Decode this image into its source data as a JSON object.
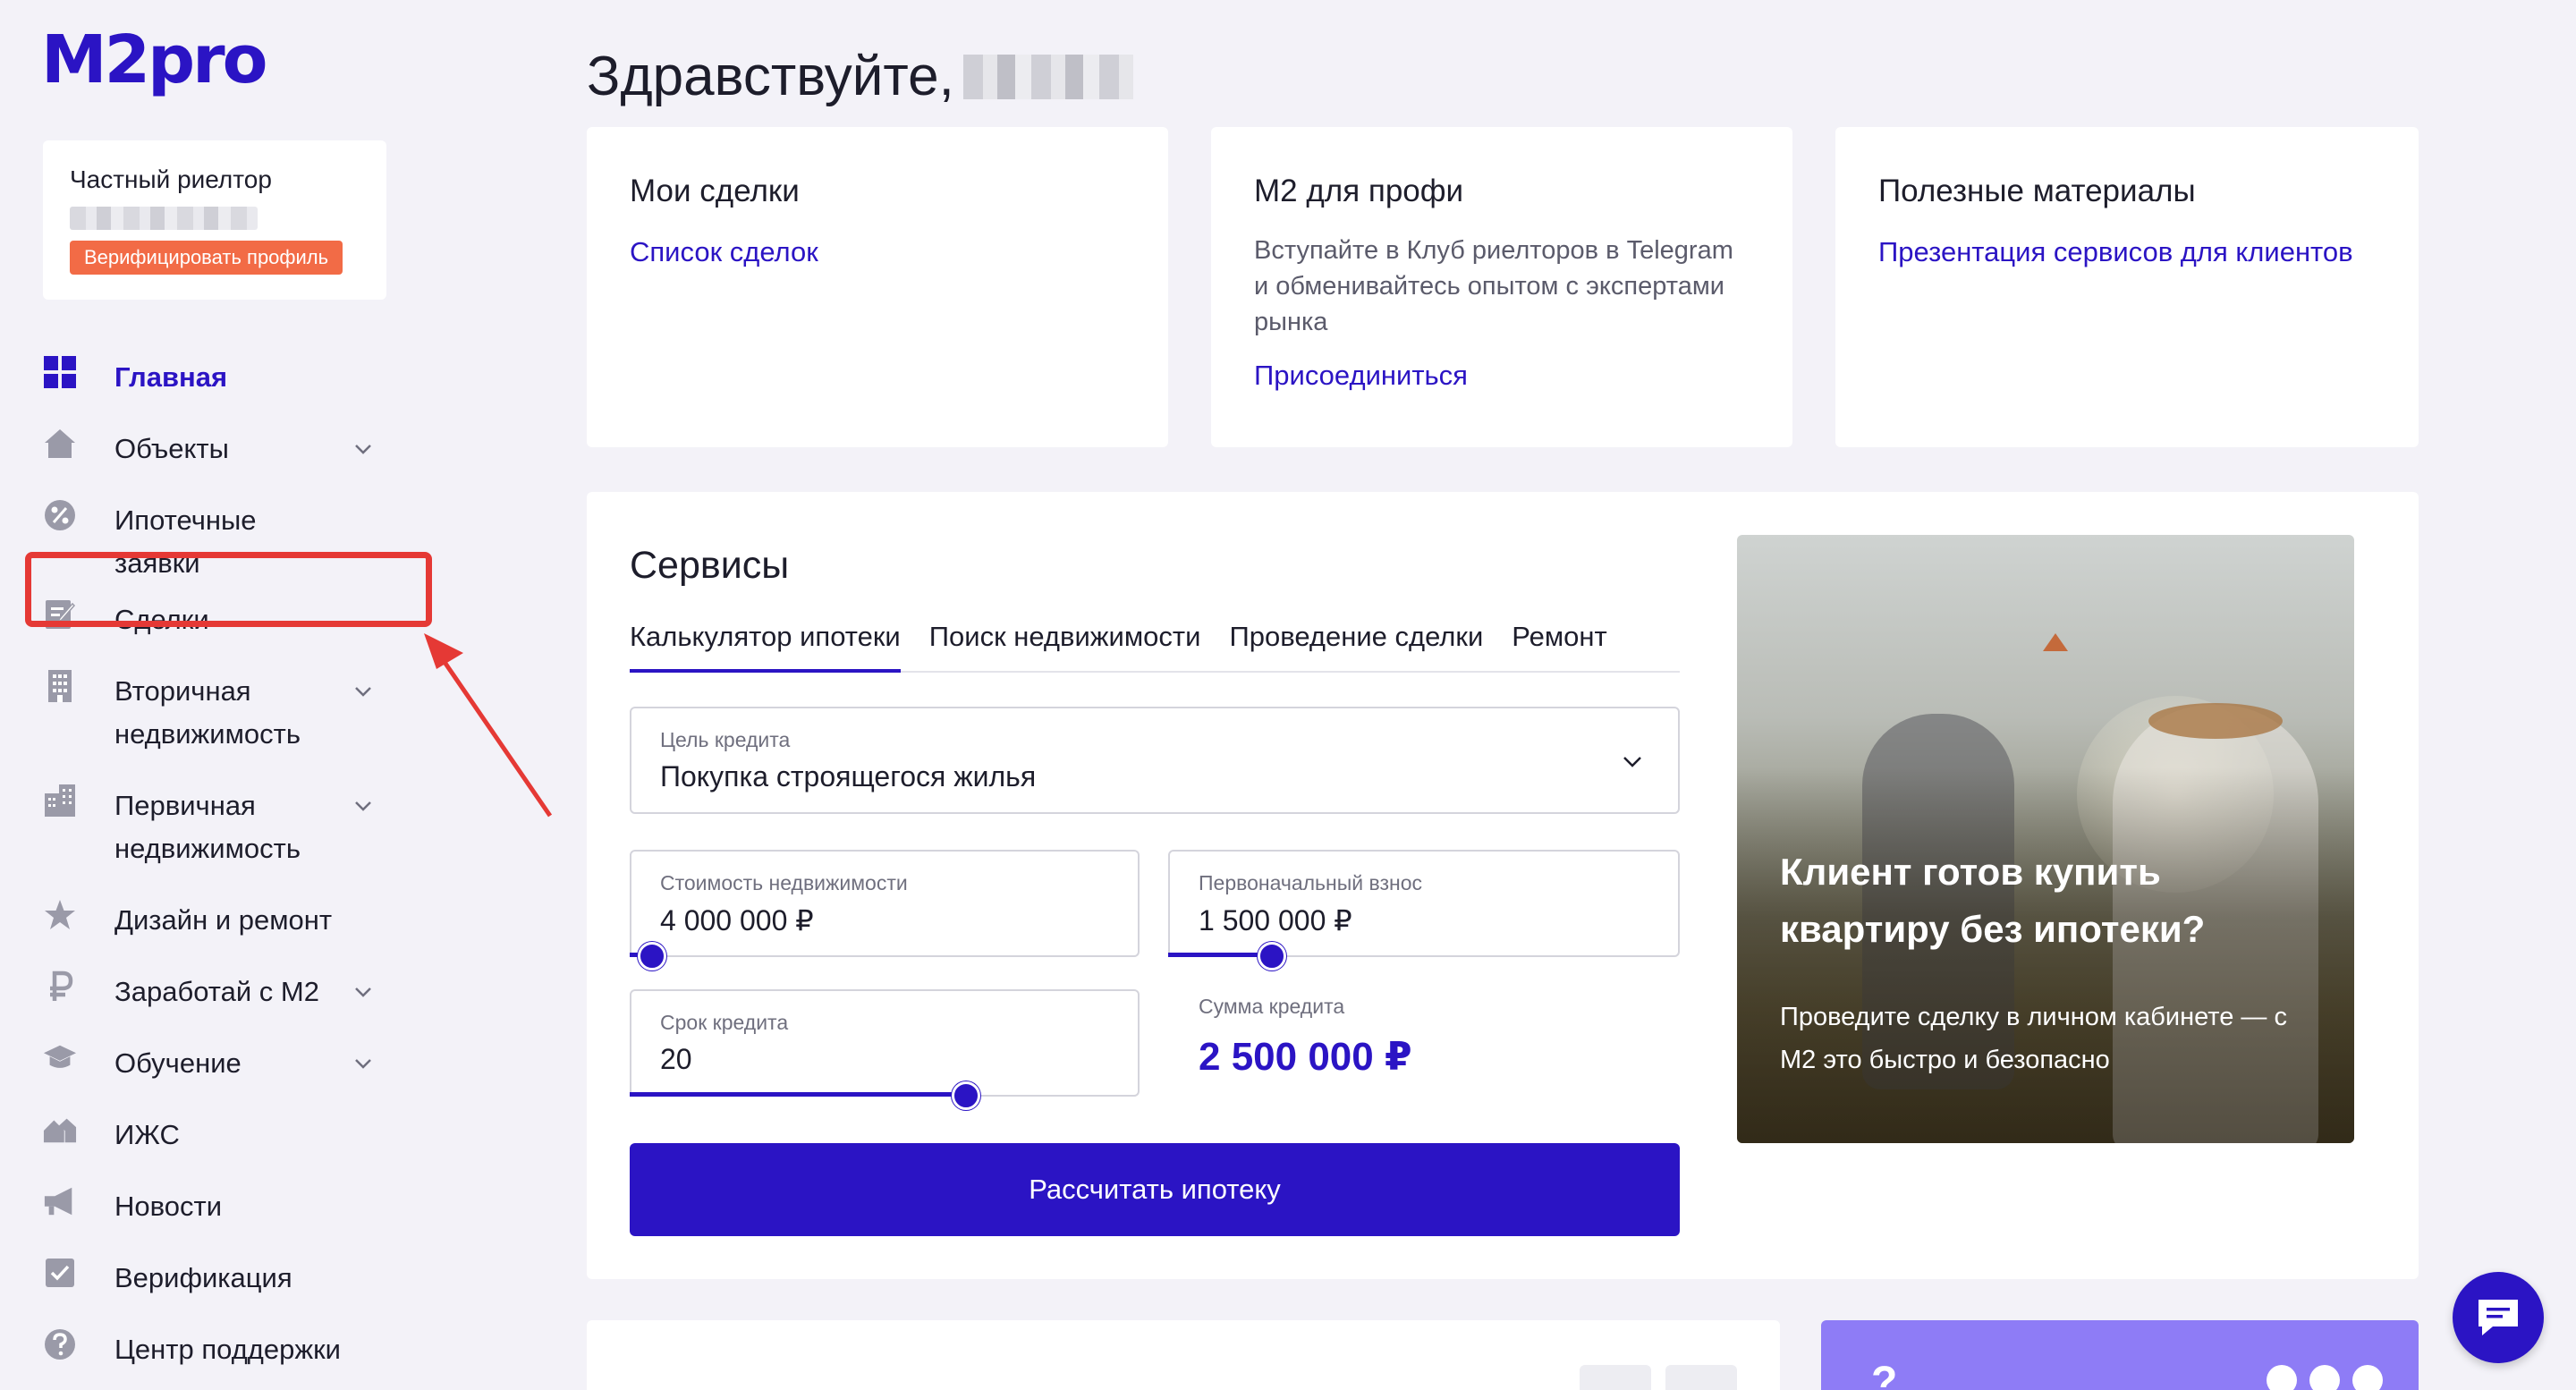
{
  "app": {
    "logo": "M2pro"
  },
  "colors": {
    "brand": "#2b14c4",
    "accent": "#f26b46",
    "highlight": "#e53935",
    "background": "#f3f2f8"
  },
  "profile": {
    "role": "Частный риелтор",
    "verify_label": "Верифицировать профиль"
  },
  "sidebar": {
    "items": [
      {
        "label": "Главная",
        "icon": "grid-icon",
        "active": true
      },
      {
        "label": "Объекты",
        "icon": "house-icon",
        "expandable": true
      },
      {
        "label": "Ипотечные заявки",
        "icon": "percent-icon"
      },
      {
        "label": "Сделки",
        "icon": "document-edit-icon",
        "highlighted": true
      },
      {
        "label": "Вторичная недвижимость",
        "icon": "building-icon",
        "expandable": true
      },
      {
        "label": "Первичная недвижимость",
        "icon": "buildings-icon",
        "expandable": true
      },
      {
        "label": "Дизайн и ремонт",
        "icon": "star-icon"
      },
      {
        "label": "Заработай с М2",
        "icon": "ruble-icon",
        "expandable": true
      },
      {
        "label": "Обучение",
        "icon": "graduation-cap-icon",
        "expandable": true
      },
      {
        "label": "ИЖС",
        "icon": "houses-icon"
      },
      {
        "label": "Новости",
        "icon": "megaphone-icon"
      },
      {
        "label": "Верификация",
        "icon": "checkbox-icon"
      },
      {
        "label": "Центр поддержки",
        "icon": "help-icon"
      }
    ]
  },
  "main": {
    "greeting": "Здравствуйте,",
    "cards": [
      {
        "title": "Мои сделки",
        "link": "Список сделок"
      },
      {
        "title": "М2 для профи",
        "description": "Вступайте в Клуб риелторов в Telegram и обменивайтесь опытом с экспертами рынка",
        "link": "Присоединиться"
      },
      {
        "title": "Полезные материалы",
        "link": "Презентация сервисов для клиентов"
      }
    ],
    "services": {
      "title": "Сервисы",
      "tabs": [
        "Калькулятор ипотеки",
        "Поиск недвижимости",
        "Проведение сделки",
        "Ремонт"
      ],
      "active_tab": 0,
      "goal": {
        "label": "Цель кредита",
        "value": "Покупка строящегося жилья"
      },
      "cost": {
        "label": "Стоимость недвижимости",
        "value": "4 000 000 ₽",
        "slider": 0.04
      },
      "down_payment": {
        "label": "Первоначальный взнос",
        "value": "1 500 000 ₽",
        "slider": 0.2
      },
      "term": {
        "label": "Срок кредита",
        "value": "20",
        "slider": 0.66
      },
      "loan_sum": {
        "label": "Сумма кредита",
        "value": "2 500 000 ₽"
      },
      "calc_button": "Рассчитать ипотеку",
      "promo": {
        "title": "Клиент готов купить квартиру без ипотеки?",
        "text": "Проведите сделку в личном кабинете — с М2 это быстро и безопасно"
      }
    },
    "bottom": {
      "purple_char": "?"
    }
  }
}
